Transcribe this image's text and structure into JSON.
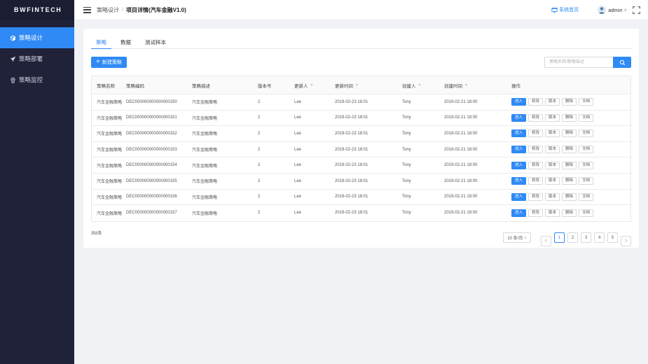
{
  "app": {
    "logo": "BWFINTECH"
  },
  "sidebar": {
    "items": [
      {
        "label": "策略设计",
        "icon": "cube-icon",
        "active": true
      },
      {
        "label": "策略部署",
        "icon": "rocket-icon",
        "active": false
      },
      {
        "label": "策略监控",
        "icon": "monitor-icon",
        "active": false
      }
    ]
  },
  "header": {
    "breadcrumb": [
      "策略设计",
      "项目详情(汽车金融V1.0)"
    ],
    "breadcrumb_sep": "/",
    "home_link": "系统首页",
    "user": "admin"
  },
  "tabs": [
    {
      "label": "策略",
      "active": true
    },
    {
      "label": "数据",
      "active": false
    },
    {
      "label": "测试样本",
      "active": false
    }
  ],
  "toolbar": {
    "new_label": "新建策略",
    "search_placeholder": "策略名称/策略描述"
  },
  "table": {
    "columns": [
      "策略名称",
      "策略编码",
      "策略描述",
      "版本号",
      "更新人",
      "更新时间",
      "创建人",
      "创建时间",
      "操作"
    ],
    "filterable": [
      false,
      false,
      false,
      false,
      true,
      true,
      true,
      true,
      false
    ],
    "actions": [
      "进入",
      "修改",
      "版本",
      "删除",
      "文档"
    ],
    "rows": [
      [
        "汽车金融策略",
        "DEC000000000000000150",
        "汽车金融策略",
        "2",
        "Lee",
        "2019-02-23 18:01",
        "Tony",
        "2019-02-21 18:00"
      ],
      [
        "汽车金融策略",
        "DEC000000000000000151",
        "汽车金融策略",
        "2",
        "Lee",
        "2019-02-23 18:01",
        "Tony",
        "2019-02-21 18:00"
      ],
      [
        "汽车金融策略",
        "DEC000000000000000152",
        "汽车金融策略",
        "2",
        "Lee",
        "2019-02-23 18:01",
        "Tony",
        "2019-02-21 18:00"
      ],
      [
        "汽车金融策略",
        "DEC000000000000000153",
        "汽车金融策略",
        "2",
        "Lee",
        "2019-02-23 18:01",
        "Tony",
        "2019-02-21 18:00"
      ],
      [
        "汽车金融策略",
        "DEC000000000000000154",
        "汽车金融策略",
        "2",
        "Lee",
        "2019-02-23 18:01",
        "Tony",
        "2019-02-21 18:00"
      ],
      [
        "汽车金融策略",
        "DEC000000000000000155",
        "汽车金融策略",
        "2",
        "Lee",
        "2019-02-23 18:01",
        "Tony",
        "2019-02-21 18:00"
      ],
      [
        "汽车金融策略",
        "DEC000000000000000156",
        "汽车金融策略",
        "2",
        "Lee",
        "2019-02-23 18:01",
        "Tony",
        "2019-02-21 18:00"
      ],
      [
        "汽车金融策略",
        "DEC000000000000000157",
        "汽车金融策略",
        "2",
        "Lee",
        "2019-02-23 18:01",
        "Tony",
        "2019-02-21 18:00"
      ]
    ]
  },
  "footer": {
    "total": "共8条",
    "page_size": "10 条/页",
    "pages": [
      "1",
      "2",
      "3",
      "4",
      "5"
    ],
    "current_page": "1",
    "prev": "<",
    "next": ">"
  },
  "colors": {
    "primary": "#2f8af5",
    "sidebar": "#20223a"
  }
}
